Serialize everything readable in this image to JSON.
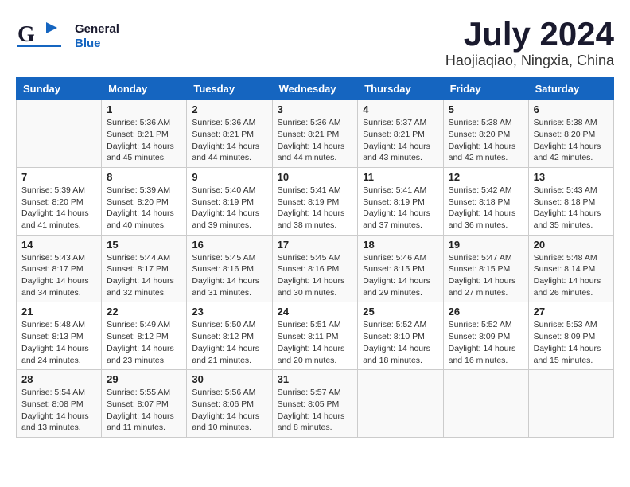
{
  "header": {
    "logo_general": "General",
    "logo_blue": "Blue",
    "title": "July 2024",
    "subtitle": "Haojiaqiao, Ningxia, China"
  },
  "calendar": {
    "days_of_week": [
      "Sunday",
      "Monday",
      "Tuesday",
      "Wednesday",
      "Thursday",
      "Friday",
      "Saturday"
    ],
    "weeks": [
      [
        {
          "day": "",
          "info": ""
        },
        {
          "day": "1",
          "info": "Sunrise: 5:36 AM\nSunset: 8:21 PM\nDaylight: 14 hours\nand 45 minutes."
        },
        {
          "day": "2",
          "info": "Sunrise: 5:36 AM\nSunset: 8:21 PM\nDaylight: 14 hours\nand 44 minutes."
        },
        {
          "day": "3",
          "info": "Sunrise: 5:36 AM\nSunset: 8:21 PM\nDaylight: 14 hours\nand 44 minutes."
        },
        {
          "day": "4",
          "info": "Sunrise: 5:37 AM\nSunset: 8:21 PM\nDaylight: 14 hours\nand 43 minutes."
        },
        {
          "day": "5",
          "info": "Sunrise: 5:38 AM\nSunset: 8:20 PM\nDaylight: 14 hours\nand 42 minutes."
        },
        {
          "day": "6",
          "info": "Sunrise: 5:38 AM\nSunset: 8:20 PM\nDaylight: 14 hours\nand 42 minutes."
        }
      ],
      [
        {
          "day": "7",
          "info": "Sunrise: 5:39 AM\nSunset: 8:20 PM\nDaylight: 14 hours\nand 41 minutes."
        },
        {
          "day": "8",
          "info": "Sunrise: 5:39 AM\nSunset: 8:20 PM\nDaylight: 14 hours\nand 40 minutes."
        },
        {
          "day": "9",
          "info": "Sunrise: 5:40 AM\nSunset: 8:19 PM\nDaylight: 14 hours\nand 39 minutes."
        },
        {
          "day": "10",
          "info": "Sunrise: 5:41 AM\nSunset: 8:19 PM\nDaylight: 14 hours\nand 38 minutes."
        },
        {
          "day": "11",
          "info": "Sunrise: 5:41 AM\nSunset: 8:19 PM\nDaylight: 14 hours\nand 37 minutes."
        },
        {
          "day": "12",
          "info": "Sunrise: 5:42 AM\nSunset: 8:18 PM\nDaylight: 14 hours\nand 36 minutes."
        },
        {
          "day": "13",
          "info": "Sunrise: 5:43 AM\nSunset: 8:18 PM\nDaylight: 14 hours\nand 35 minutes."
        }
      ],
      [
        {
          "day": "14",
          "info": "Sunrise: 5:43 AM\nSunset: 8:17 PM\nDaylight: 14 hours\nand 34 minutes."
        },
        {
          "day": "15",
          "info": "Sunrise: 5:44 AM\nSunset: 8:17 PM\nDaylight: 14 hours\nand 32 minutes."
        },
        {
          "day": "16",
          "info": "Sunrise: 5:45 AM\nSunset: 8:16 PM\nDaylight: 14 hours\nand 31 minutes."
        },
        {
          "day": "17",
          "info": "Sunrise: 5:45 AM\nSunset: 8:16 PM\nDaylight: 14 hours\nand 30 minutes."
        },
        {
          "day": "18",
          "info": "Sunrise: 5:46 AM\nSunset: 8:15 PM\nDaylight: 14 hours\nand 29 minutes."
        },
        {
          "day": "19",
          "info": "Sunrise: 5:47 AM\nSunset: 8:15 PM\nDaylight: 14 hours\nand 27 minutes."
        },
        {
          "day": "20",
          "info": "Sunrise: 5:48 AM\nSunset: 8:14 PM\nDaylight: 14 hours\nand 26 minutes."
        }
      ],
      [
        {
          "day": "21",
          "info": "Sunrise: 5:48 AM\nSunset: 8:13 PM\nDaylight: 14 hours\nand 24 minutes."
        },
        {
          "day": "22",
          "info": "Sunrise: 5:49 AM\nSunset: 8:12 PM\nDaylight: 14 hours\nand 23 minutes."
        },
        {
          "day": "23",
          "info": "Sunrise: 5:50 AM\nSunset: 8:12 PM\nDaylight: 14 hours\nand 21 minutes."
        },
        {
          "day": "24",
          "info": "Sunrise: 5:51 AM\nSunset: 8:11 PM\nDaylight: 14 hours\nand 20 minutes."
        },
        {
          "day": "25",
          "info": "Sunrise: 5:52 AM\nSunset: 8:10 PM\nDaylight: 14 hours\nand 18 minutes."
        },
        {
          "day": "26",
          "info": "Sunrise: 5:52 AM\nSunset: 8:09 PM\nDaylight: 14 hours\nand 16 minutes."
        },
        {
          "day": "27",
          "info": "Sunrise: 5:53 AM\nSunset: 8:09 PM\nDaylight: 14 hours\nand 15 minutes."
        }
      ],
      [
        {
          "day": "28",
          "info": "Sunrise: 5:54 AM\nSunset: 8:08 PM\nDaylight: 14 hours\nand 13 minutes."
        },
        {
          "day": "29",
          "info": "Sunrise: 5:55 AM\nSunset: 8:07 PM\nDaylight: 14 hours\nand 11 minutes."
        },
        {
          "day": "30",
          "info": "Sunrise: 5:56 AM\nSunset: 8:06 PM\nDaylight: 14 hours\nand 10 minutes."
        },
        {
          "day": "31",
          "info": "Sunrise: 5:57 AM\nSunset: 8:05 PM\nDaylight: 14 hours\nand 8 minutes."
        },
        {
          "day": "",
          "info": ""
        },
        {
          "day": "",
          "info": ""
        },
        {
          "day": "",
          "info": ""
        }
      ]
    ]
  }
}
